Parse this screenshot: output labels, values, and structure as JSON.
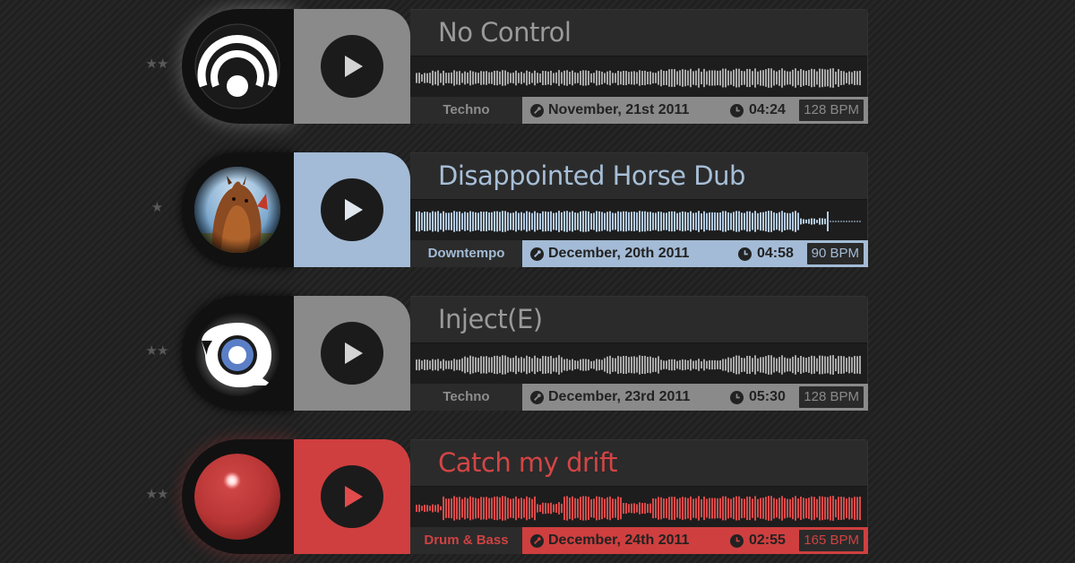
{
  "tracks": [
    {
      "stars": "★★",
      "title": "No Control",
      "genre": "Techno",
      "date": "November, 21st 2011",
      "duration": "04:24",
      "bpm": "128 BPM",
      "art": "concentric-rings-logo",
      "colors": {
        "accent": "#8a8a8a",
        "title": "#9a9a9a",
        "wave": "#a8a8a8",
        "genre_text": "#8d8d8d",
        "bpm_text": "#8a8a8a"
      }
    },
    {
      "stars": "★",
      "title": "Disappointed Horse Dub",
      "genre": "Downtempo",
      "date": "December, 20th 2011",
      "duration": "04:58",
      "bpm": "90 BPM",
      "art": "horse-photo",
      "colors": {
        "accent": "#a3bbd6",
        "title": "#a7bfd8",
        "wave": "#b3c9e1",
        "genre_text": "#a3bbd6",
        "bpm_text": "#a3bbd6"
      }
    },
    {
      "stars": "★★",
      "title": "Inject(E)",
      "genre": "Techno",
      "date": "December, 23rd 2011",
      "duration": "05:30",
      "bpm": "128 BPM",
      "art": "q-ring-logo",
      "colors": {
        "accent": "#8a8a8a",
        "title": "#9a9a9a",
        "wave": "#a8a8a8",
        "genre_text": "#8d8d8d",
        "bpm_text": "#8a8a8a"
      }
    },
    {
      "stars": "★★",
      "title": "Catch my drift",
      "genre": "Drum & Bass",
      "date": "December, 24th 2011",
      "duration": "02:55",
      "bpm": "165 BPM",
      "art": "red-orb-logo",
      "colors": {
        "accent": "#cf3f3f",
        "title": "#d44545",
        "wave": "#d94a4a",
        "genre_text": "#cf4242",
        "bpm_text": "#cf4242"
      }
    }
  ]
}
